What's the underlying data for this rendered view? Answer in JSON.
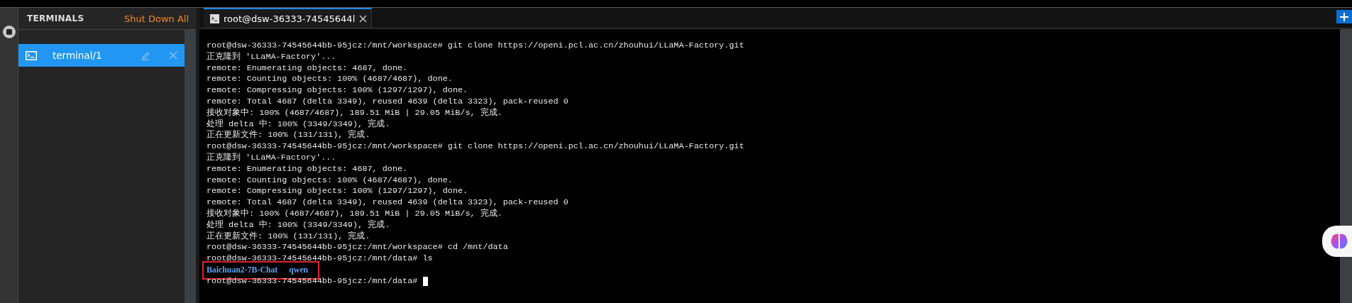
{
  "sidebar": {
    "title": "TERMINALS",
    "action": "Shut Down All",
    "items": [
      {
        "label": "terminal/1",
        "selected": true
      }
    ]
  },
  "tabs": [
    {
      "label": "root@dsw-36333-74545644l",
      "selected": true
    }
  ],
  "terminal": {
    "lines": [
      {
        "kind": "text",
        "text": "root@dsw-36333-74545644bb-95jcz:/mnt/workspace# git clone https://openi.pcl.ac.cn/zhouhui/LLaMA-Factory.git"
      },
      {
        "kind": "text",
        "text": "正克隆到 'LLaMA-Factory'..."
      },
      {
        "kind": "text",
        "text": "remote: Enumerating objects: 4687, done."
      },
      {
        "kind": "text",
        "text": "remote: Counting objects: 100% (4687/4687), done."
      },
      {
        "kind": "text",
        "text": "remote: Compressing objects: 100% (1297/1297), done."
      },
      {
        "kind": "text",
        "text": "remote: Total 4687 (delta 3349), reused 4639 (delta 3323), pack-reused 0"
      },
      {
        "kind": "text",
        "text": "接收对象中: 100% (4687/4687), 189.51 MiB | 29.05 MiB/s, 完成."
      },
      {
        "kind": "text",
        "text": "处理 delta 中: 100% (3349/3349), 完成."
      },
      {
        "kind": "text",
        "text": "正在更新文件: 100% (131/131), 完成."
      },
      {
        "kind": "text",
        "text": "root@dsw-36333-74545644bb-95jcz:/mnt/workspace# git clone https://openi.pcl.ac.cn/zhouhui/LLaMA-Factory.git"
      },
      {
        "kind": "text",
        "text": "正克隆到 'LLaMA-Factory'..."
      },
      {
        "kind": "text",
        "text": "remote: Enumerating objects: 4687, done."
      },
      {
        "kind": "text",
        "text": "remote: Counting objects: 100% (4687/4687), done."
      },
      {
        "kind": "text",
        "text": "remote: Compressing objects: 100% (1297/1297), done."
      },
      {
        "kind": "text",
        "text": "remote: Total 4687 (delta 3349), reused 4639 (delta 3323), pack-reused 0"
      },
      {
        "kind": "text",
        "text": "接收对象中: 100% (4687/4687), 189.51 MiB | 29.05 MiB/s, 完成."
      },
      {
        "kind": "text",
        "text": "处理 delta 中: 100% (3349/3349), 完成."
      },
      {
        "kind": "text",
        "text": "正在更新文件: 100% (131/131), 完成."
      },
      {
        "kind": "text",
        "text": "root@dsw-36333-74545644bb-95jcz:/mnt/workspace# cd /mnt/data"
      },
      {
        "kind": "text",
        "text": "root@dsw-36333-74545644bb-95jcz:/mnt/data# ls"
      },
      {
        "kind": "listing",
        "highlighted": true,
        "entries": [
          "Baichuan2-7B-Chat",
          "qwen"
        ]
      },
      {
        "kind": "text",
        "text": "root@dsw-36333-74545644bb-95jcz:/mnt/data#",
        "cursor": true
      }
    ]
  }
}
